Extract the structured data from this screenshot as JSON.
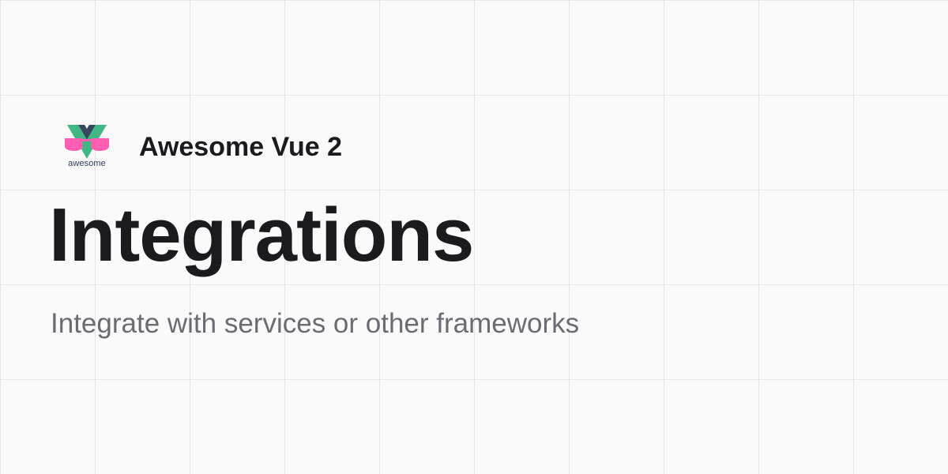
{
  "brand": {
    "logo_caption": "awesome",
    "site_name": "Awesome Vue 2"
  },
  "page": {
    "title": "Integrations",
    "subtitle": "Integrate with services or other frameworks"
  },
  "colors": {
    "vue_green": "#41b883",
    "vue_navy": "#35495e",
    "glasses_pink": "#ff5fb2",
    "title_text": "#1b1b1f",
    "subtitle_text": "#6b6b73",
    "grid_line": "#e6e6e6",
    "background": "#fafafa"
  },
  "icons": {
    "logo": "awesome-vue-logo-icon"
  }
}
